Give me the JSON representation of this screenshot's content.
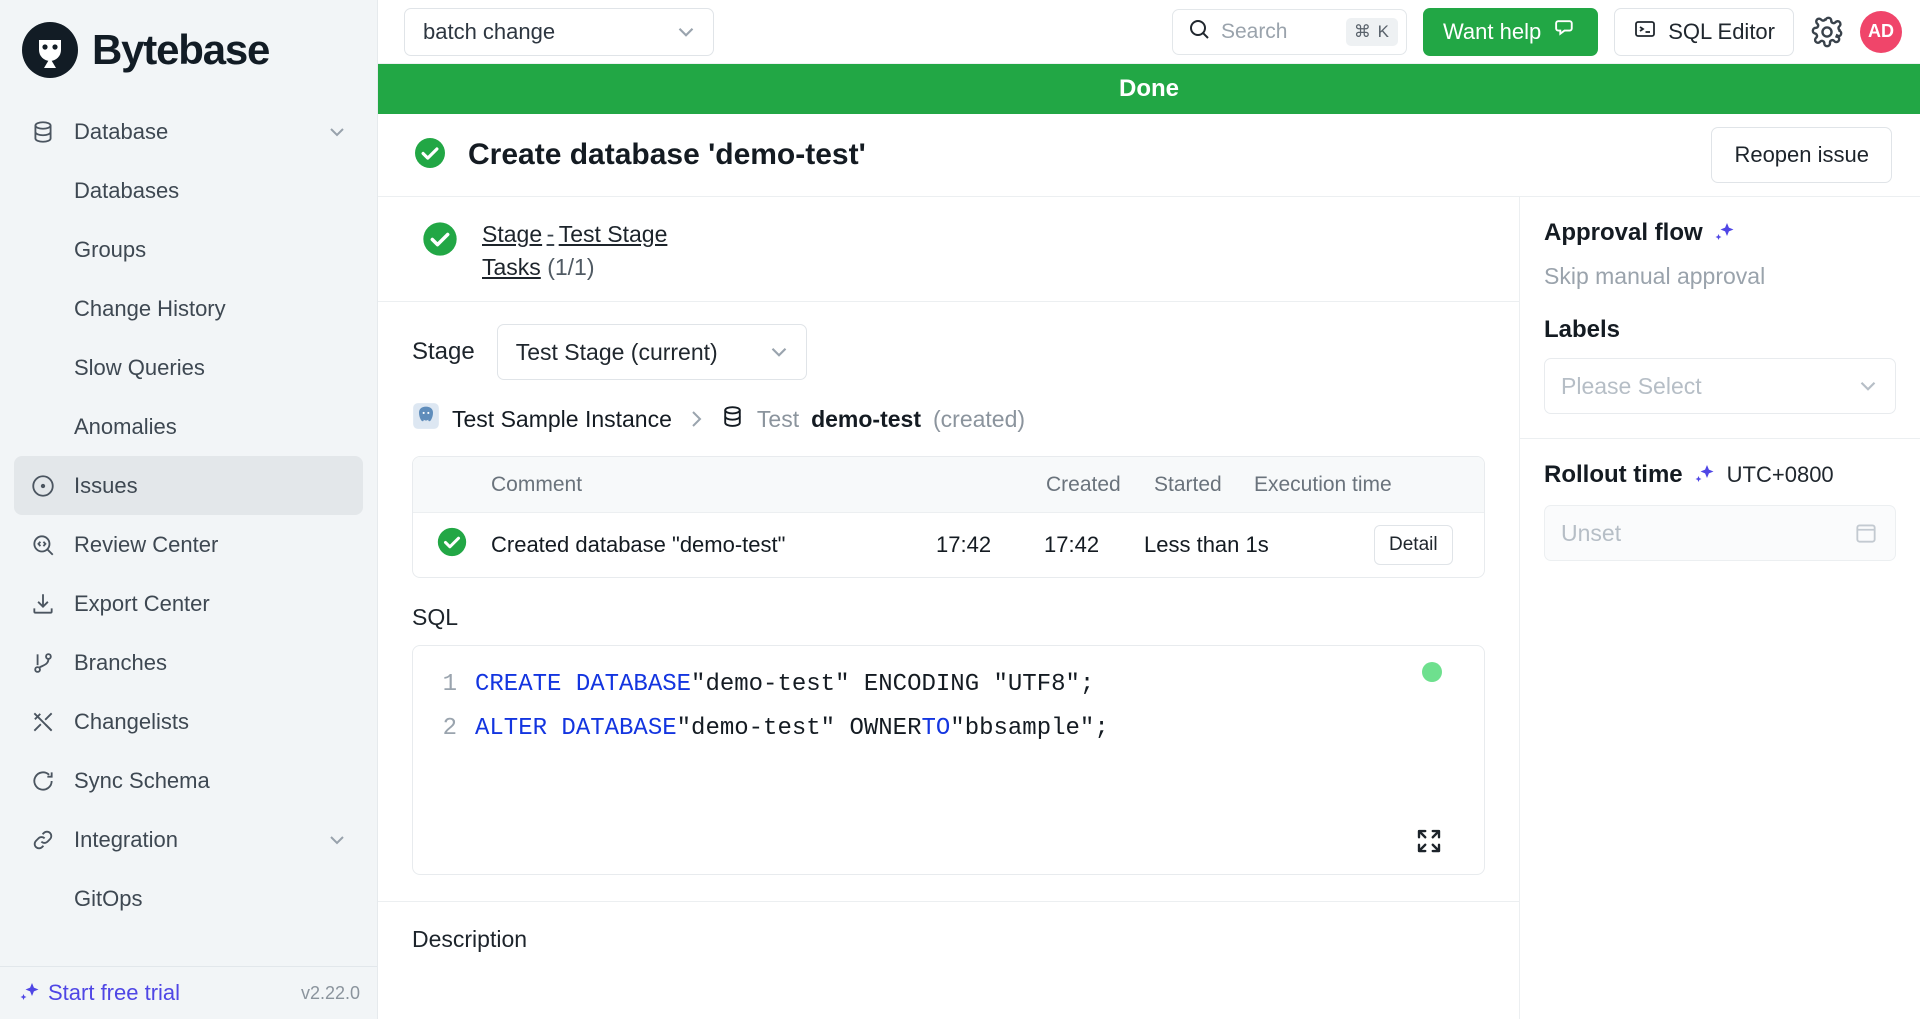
{
  "brand": {
    "name": "Bytebase",
    "logo_icon": "bytebase-logo-icon"
  },
  "sidebar": {
    "items": [
      {
        "label": "Database",
        "icon": "database-icon",
        "type": "group",
        "expanded": true,
        "chevron": "chevron-down-icon"
      },
      {
        "label": "Databases",
        "type": "sub"
      },
      {
        "label": "Groups",
        "type": "sub"
      },
      {
        "label": "Change History",
        "type": "sub"
      },
      {
        "label": "Slow Queries",
        "type": "sub"
      },
      {
        "label": "Anomalies",
        "type": "sub"
      },
      {
        "label": "Issues",
        "icon": "issues-circle-dot-icon",
        "type": "item",
        "active": true
      },
      {
        "label": "Review Center",
        "icon": "review-code-search-icon",
        "type": "item"
      },
      {
        "label": "Export Center",
        "icon": "download-icon",
        "type": "item"
      },
      {
        "label": "Branches",
        "icon": "branch-icon",
        "type": "item"
      },
      {
        "label": "Changelists",
        "icon": "changelists-icon",
        "type": "item"
      },
      {
        "label": "Sync Schema",
        "icon": "sync-refresh-icon",
        "type": "item"
      },
      {
        "label": "Integration",
        "icon": "link-icon",
        "type": "group",
        "chevron": "chevron-down-icon"
      },
      {
        "label": "GitOps",
        "type": "sub"
      }
    ],
    "footer": {
      "trial_label": "Start free trial",
      "trial_icon": "sparkle-icon",
      "version": "v2.22.0"
    }
  },
  "topbar": {
    "project": "batch change",
    "project_chevron": "chevron-down-icon",
    "search": {
      "placeholder": "Search",
      "icon": "search-icon",
      "shortcut": "⌘ K"
    },
    "want_help": {
      "label": "Want help",
      "icon": "chat-bubble-icon",
      "color": "#22a745"
    },
    "sql_editor": {
      "label": "SQL Editor",
      "icon": "terminal-icon"
    },
    "settings_icon": "gear-icon",
    "avatar": {
      "initials": "AD",
      "color": "#f0456a"
    }
  },
  "issue": {
    "status_banner": "Done",
    "status_color": "#22a745",
    "status_icon": "check-circle-icon",
    "title": "Create database 'demo-test'",
    "reopen_label": "Reopen issue"
  },
  "stage_summary": {
    "status_icon": "check-circle-icon",
    "stage_word": "Stage",
    "dash": "-",
    "stage_name": "Test Stage",
    "tasks_word": "Tasks",
    "tasks_count": "(1/1)"
  },
  "stage_picker": {
    "label": "Stage",
    "selected": "Test Stage (current)",
    "chevron": "chevron-down-icon"
  },
  "breadcrumb": {
    "instance_icon": "postgres-elephant-icon",
    "instance": "Test Sample Instance",
    "separator_icon": "chevron-right-icon",
    "db_icon": "database-icon",
    "environment": "Test",
    "database": "demo-test",
    "state": "(created)"
  },
  "task_table": {
    "columns": [
      "",
      "Comment",
      "Created",
      "Started",
      "Execution time",
      ""
    ],
    "rows": [
      {
        "status_icon": "check-circle-icon",
        "comment": "Created database \"demo-test\"",
        "created": "17:42",
        "started": "17:42",
        "execution_time": "Less than 1s",
        "detail_label": "Detail"
      }
    ]
  },
  "sql": {
    "label": "SQL",
    "lines": [
      {
        "no": "1",
        "kw1": "CREATE DATABASE",
        "rest": " \"demo-test\" ENCODING \"UTF8\";"
      },
      {
        "no": "2",
        "kw1": "ALTER DATABASE",
        "mid": " \"demo-test\" OWNER ",
        "kw2": "TO",
        "rest": " \"bbsample\";"
      }
    ],
    "status_dot_color": "#6ee08e",
    "expand_icon": "expand-fullscreen-icon"
  },
  "description": {
    "label": "Description"
  },
  "right_panel": {
    "approval": {
      "title": "Approval flow",
      "sparkle_icon": "sparkle-icon",
      "value": "Skip manual approval"
    },
    "labels": {
      "title": "Labels",
      "placeholder": "Please Select",
      "chevron": "chevron-down-icon"
    },
    "rollout": {
      "title": "Rollout time",
      "sparkle_icon": "sparkle-icon",
      "timezone": "UTC+0800",
      "placeholder": "Unset",
      "calendar_icon": "calendar-icon"
    }
  }
}
